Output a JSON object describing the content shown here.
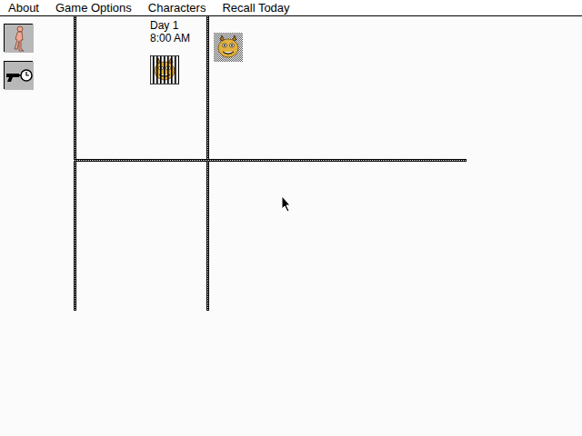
{
  "menu": [
    "About",
    "Game Options",
    "Characters",
    "Recall Today"
  ],
  "clock": {
    "day": "Day 1",
    "time": "8:00 AM"
  },
  "portraits": [
    {
      "kind": "jailed"
    },
    {
      "kind": "highlighted"
    }
  ]
}
